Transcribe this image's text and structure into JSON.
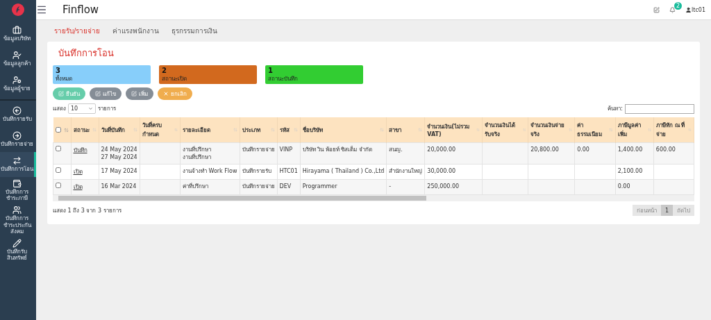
{
  "app": {
    "title": "Finflow"
  },
  "topbar": {
    "notifications": "2",
    "user": "ltc01"
  },
  "sidebar": {
    "items": [
      {
        "label": "ข้อมูลบริษัท",
        "selected": false
      },
      {
        "label": "ข้อมูลลูกค้า",
        "selected": false
      },
      {
        "label": "ข้อมูลผู้ขาย",
        "selected": false
      },
      {
        "label": "บันทึกรายรับ",
        "selected": false
      },
      {
        "label": "บันทึกรายจ่าย",
        "selected": false
      },
      {
        "label": "บันทึกการโอน",
        "selected": true
      },
      {
        "label": "บันทึกการชำระภาษี",
        "selected": false
      },
      {
        "label": "บันทึกการชำระประกันสังคม",
        "selected": false
      },
      {
        "label": "บันทึกรับสินทรัพย์",
        "selected": false
      }
    ]
  },
  "tabs": [
    {
      "label": "รายรับ/รายจ่าย",
      "selected": true
    },
    {
      "label": "ค่าแรงพนักงาน",
      "selected": false
    },
    {
      "label": "ธุรกรรมการเงิน",
      "selected": false
    }
  ],
  "page_title": "บันทึกการโอน",
  "summary_cards": [
    {
      "count": "3",
      "label": "ทั้งหมด",
      "color": "#87cefa"
    },
    {
      "count": "2",
      "label": "สถานะเปิด",
      "color": "#d2691e"
    },
    {
      "count": "1",
      "label": "สถานะบันทึก",
      "color": "#32cd32"
    }
  ],
  "actions": [
    {
      "label": "ยืนยัน",
      "kind": "edit",
      "color": "#66cdaa"
    },
    {
      "label": "แก้ไข",
      "kind": "edit",
      "color": "#858d96"
    },
    {
      "label": "เพิ่ม",
      "kind": "edit",
      "color": "#858d96"
    },
    {
      "label": "ยกเลิก",
      "kind": "cancel",
      "color": "#f0ad4e"
    }
  ],
  "length_control": {
    "before": "แสดง",
    "value": "10",
    "after": "รายการ"
  },
  "search": {
    "label": "ค้นหา:"
  },
  "table": {
    "select_all_checked": false,
    "columns": [
      "สถานะ",
      "วันที่บันทึก",
      "วันที่ครบกำหนด",
      "รายละเอียด",
      "ประเภท",
      "รหัส",
      "ชื่อบริษัท",
      "สาขา",
      "จำนวนเงิน(ไม่รวม VAT)",
      "จำนวนเงินได้รับจริง",
      "จำนวนเงินจ่ายจริง",
      "ค่าธรรมเนียม",
      "ภาษีมูลค่าเพิ่ม",
      "ภาษีหัก ณ ที่จ่าย"
    ],
    "rows": [
      {
        "checked": false,
        "cells": [
          [
            "บันทึก"
          ],
          [
            "24 May 2024",
            "27 May 2024"
          ],
          [],
          [
            "งานที่ปรึกษา",
            "งานที่ปรึกษา"
          ],
          [
            "บันทึกรายจ่าย"
          ],
          [
            "VINP"
          ],
          [
            "บริษัท วิน พ้อยท์ ซิสเต็ม จำกัด"
          ],
          [
            "สนญ."
          ],
          [
            "20,000.00"
          ],
          [],
          [
            "20,800.00"
          ],
          [
            "0.00"
          ],
          [
            "1,400.00"
          ],
          [
            "600.00"
          ]
        ]
      },
      {
        "checked": false,
        "cells": [
          [
            "เปิด"
          ],
          [
            "17 May 2024"
          ],
          [],
          [
            "งานจ้างทำ Work Flow"
          ],
          [
            "บันทึกรายรับ"
          ],
          [
            "HTC01"
          ],
          [
            "Hirayama ( Thailand ) Co.,Ltd"
          ],
          [
            "สำนักงานใหญ่"
          ],
          [
            "30,000.00"
          ],
          [],
          [],
          [],
          [
            "2,100.00"
          ],
          []
        ]
      },
      {
        "checked": false,
        "cells": [
          [
            "เปิด"
          ],
          [
            "16 Mar 2024"
          ],
          [],
          [
            "ค่าที่ปรึกษา"
          ],
          [
            "บันทึกรายจ่าย"
          ],
          [
            "DEV"
          ],
          [
            "Programmer"
          ],
          [
            "-"
          ],
          [
            "250,000.00"
          ],
          [],
          [],
          [],
          [
            "0.00"
          ],
          []
        ]
      }
    ]
  },
  "info": "แสดง 1 ถึง 3 จาก 3 รายการ",
  "pagination": {
    "previous": "ก่อนหน้า",
    "page": "1",
    "next": "ถัดไป"
  }
}
